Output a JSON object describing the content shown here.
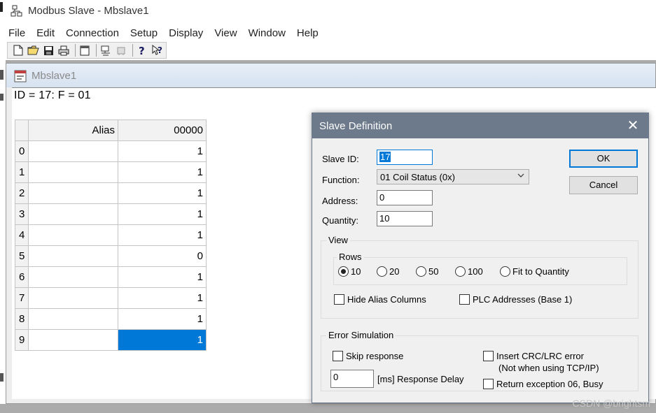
{
  "app": {
    "title": "Modbus Slave - Mbslave1"
  },
  "menu": [
    "File",
    "Edit",
    "Connection",
    "Setup",
    "Display",
    "View",
    "Window",
    "Help"
  ],
  "toolbar": {
    "icons": [
      "new-file-icon",
      "open-folder-icon",
      "save-icon",
      "print-icon",
      "window-icon",
      "connect-icon",
      "disconnect-icon",
      "help-icon",
      "context-help-icon"
    ]
  },
  "child_window": {
    "title": "Mbslave1",
    "id_line": "ID = 17: F = 01",
    "grid": {
      "headers": [
        "",
        "Alias",
        "00000"
      ],
      "rows": [
        {
          "num": "0",
          "alias": "",
          "value": "1"
        },
        {
          "num": "1",
          "alias": "",
          "value": "1"
        },
        {
          "num": "2",
          "alias": "",
          "value": "1"
        },
        {
          "num": "3",
          "alias": "",
          "value": "1"
        },
        {
          "num": "4",
          "alias": "",
          "value": "1"
        },
        {
          "num": "5",
          "alias": "",
          "value": "0"
        },
        {
          "num": "6",
          "alias": "",
          "value": "1"
        },
        {
          "num": "7",
          "alias": "",
          "value": "1"
        },
        {
          "num": "8",
          "alias": "",
          "value": "1"
        },
        {
          "num": "9",
          "alias": "",
          "value": "1"
        }
      ],
      "selected_row": 9,
      "selection_color": "#0078d7"
    }
  },
  "dialog": {
    "title": "Slave Definition",
    "slave_id_label": "Slave ID:",
    "slave_id_value": "17",
    "function_label": "Function:",
    "function_value": "01 Coil Status (0x)",
    "address_label": "Address:",
    "address_value": "0",
    "quantity_label": "Quantity:",
    "quantity_value": "10",
    "ok_label": "OK",
    "cancel_label": "Cancel",
    "view": {
      "label": "View",
      "rows_label": "Rows",
      "rows_options": [
        "10",
        "20",
        "50",
        "100",
        "Fit to Quantity"
      ],
      "rows_selected": "10",
      "hide_alias_label": "Hide Alias Columns",
      "plc_addresses_label": "PLC Addresses (Base 1)"
    },
    "error_sim": {
      "label": "Error Simulation",
      "skip_response_label": "Skip response",
      "response_delay_value": "0",
      "response_delay_label": "[ms] Response Delay",
      "insert_crc_label": "Insert CRC/LRC error",
      "insert_crc_note": "(Not when using TCP/IP)",
      "return_exception_label": "Return exception 06, Busy"
    }
  },
  "watermark": "CSDN @brightsm"
}
